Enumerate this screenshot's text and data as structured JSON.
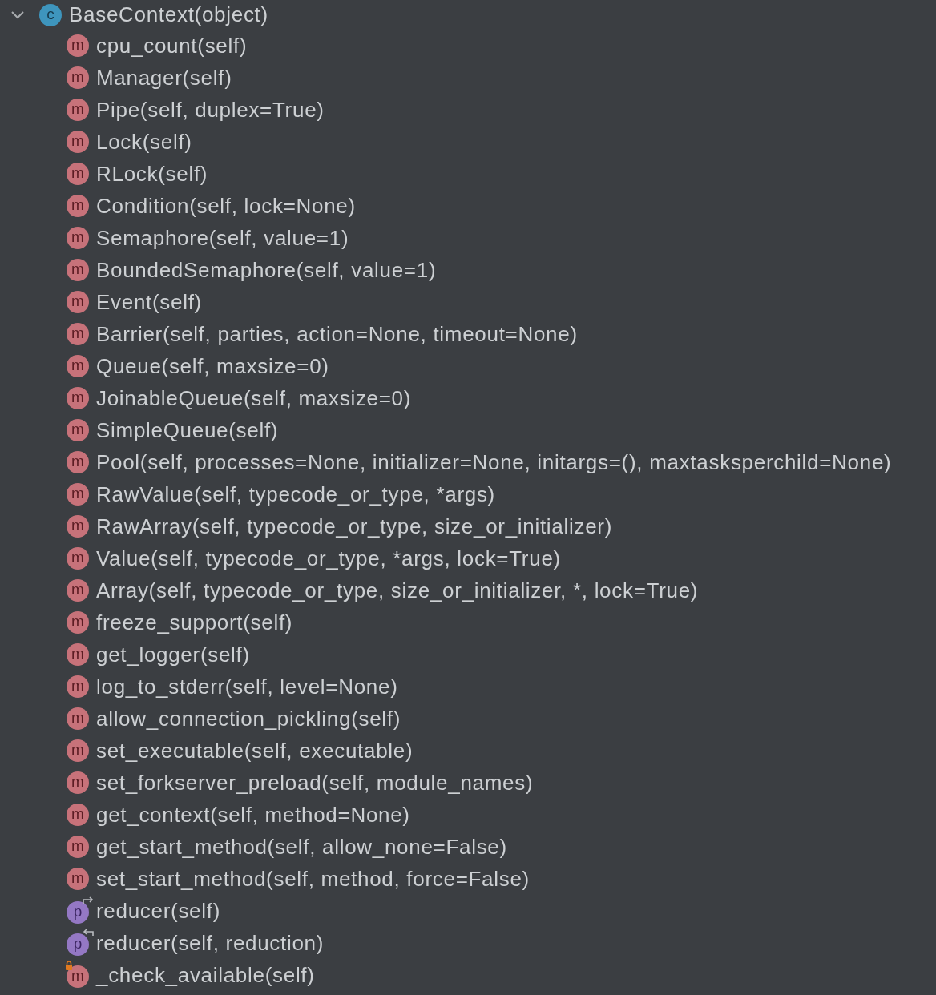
{
  "tree": {
    "expanded": true,
    "badge": "c",
    "label": "BaseContext(object)",
    "children": [
      {
        "kind": "method",
        "badge": "m",
        "label": "cpu_count(self)"
      },
      {
        "kind": "method",
        "badge": "m",
        "label": "Manager(self)"
      },
      {
        "kind": "method",
        "badge": "m",
        "label": "Pipe(self, duplex=True)"
      },
      {
        "kind": "method",
        "badge": "m",
        "label": "Lock(self)"
      },
      {
        "kind": "method",
        "badge": "m",
        "label": "RLock(self)"
      },
      {
        "kind": "method",
        "badge": "m",
        "label": "Condition(self, lock=None)"
      },
      {
        "kind": "method",
        "badge": "m",
        "label": "Semaphore(self, value=1)"
      },
      {
        "kind": "method",
        "badge": "m",
        "label": "BoundedSemaphore(self, value=1)"
      },
      {
        "kind": "method",
        "badge": "m",
        "label": "Event(self)"
      },
      {
        "kind": "method",
        "badge": "m",
        "label": "Barrier(self, parties, action=None, timeout=None)"
      },
      {
        "kind": "method",
        "badge": "m",
        "label": "Queue(self, maxsize=0)"
      },
      {
        "kind": "method",
        "badge": "m",
        "label": "JoinableQueue(self, maxsize=0)"
      },
      {
        "kind": "method",
        "badge": "m",
        "label": "SimpleQueue(self)"
      },
      {
        "kind": "method",
        "badge": "m",
        "label": "Pool(self, processes=None, initializer=None, initargs=(), maxtasksperchild=None)"
      },
      {
        "kind": "method",
        "badge": "m",
        "label": "RawValue(self, typecode_or_type, *args)"
      },
      {
        "kind": "method",
        "badge": "m",
        "label": "RawArray(self, typecode_or_type, size_or_initializer)"
      },
      {
        "kind": "method",
        "badge": "m",
        "label": "Value(self, typecode_or_type, *args, lock=True)"
      },
      {
        "kind": "method",
        "badge": "m",
        "label": "Array(self, typecode_or_type, size_or_initializer, *, lock=True)"
      },
      {
        "kind": "method",
        "badge": "m",
        "label": "freeze_support(self)"
      },
      {
        "kind": "method",
        "badge": "m",
        "label": "get_logger(self)"
      },
      {
        "kind": "method",
        "badge": "m",
        "label": "log_to_stderr(self, level=None)"
      },
      {
        "kind": "method",
        "badge": "m",
        "label": "allow_connection_pickling(self)"
      },
      {
        "kind": "method",
        "badge": "m",
        "label": "set_executable(self, executable)"
      },
      {
        "kind": "method",
        "badge": "m",
        "label": "set_forkserver_preload(self, module_names)"
      },
      {
        "kind": "method",
        "badge": "m",
        "label": "get_context(self, method=None)"
      },
      {
        "kind": "method",
        "badge": "m",
        "label": "get_start_method(self, allow_none=False)"
      },
      {
        "kind": "method",
        "badge": "m",
        "label": "set_start_method(self, method, force=False)"
      },
      {
        "kind": "getter",
        "badge": "p",
        "label": "reducer(self)"
      },
      {
        "kind": "setter",
        "badge": "p",
        "label": "reducer(self, reduction)"
      },
      {
        "kind": "private",
        "badge": "m",
        "label": "_check_available(self)"
      }
    ]
  }
}
